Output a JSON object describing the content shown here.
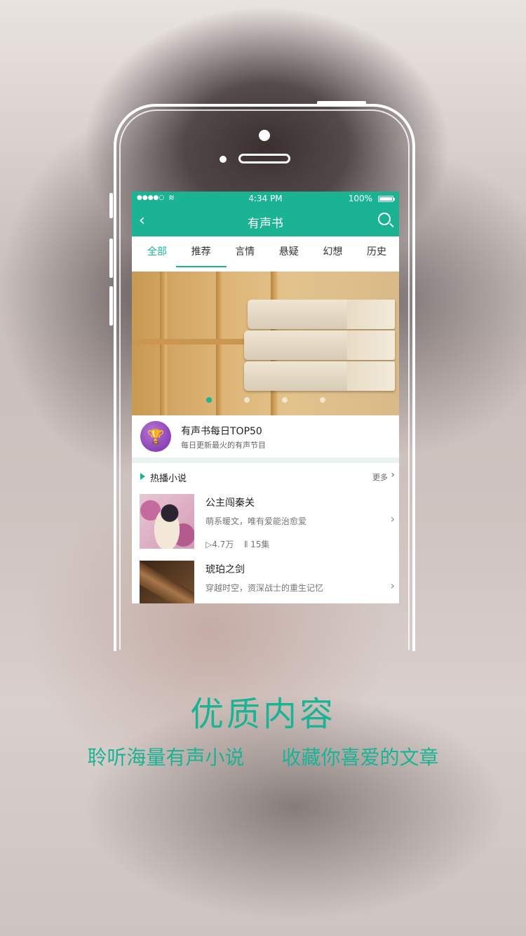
{
  "status_bar": {
    "signal": "●●●●○",
    "wifi": "≋",
    "time": "4:34 PM",
    "battery": "100%"
  },
  "nav": {
    "back": "‹",
    "title": "有声书"
  },
  "tabs": [
    {
      "label": "全部"
    },
    {
      "label": "推荐"
    },
    {
      "label": "言情"
    },
    {
      "label": "悬疑"
    },
    {
      "label": "幻想"
    },
    {
      "label": "历史"
    }
  ],
  "banner": {
    "active_dot": 0,
    "dot_count": 4
  },
  "top50": {
    "icon": "trophy-icon",
    "title": "有声书每日TOP50",
    "subtitle": "每日更新最火的有声节目"
  },
  "hot_section": {
    "title": "热播小说",
    "more": "更多"
  },
  "items": [
    {
      "name": "公主闯秦关",
      "desc": "萌系暖文，唯有爱能治愈爱",
      "plays": "▷4.7万",
      "episodes": "15集"
    },
    {
      "name": "琥珀之剑",
      "desc": "穿越时空，资深战士的重生记忆"
    }
  ],
  "promo": {
    "headline": "优质内容",
    "sub_left": "聆听海量有声小说",
    "sub_right": "收藏你喜爱的文章"
  },
  "colors": {
    "accent": "#1ab394",
    "trophy": "#8e3fbf"
  }
}
